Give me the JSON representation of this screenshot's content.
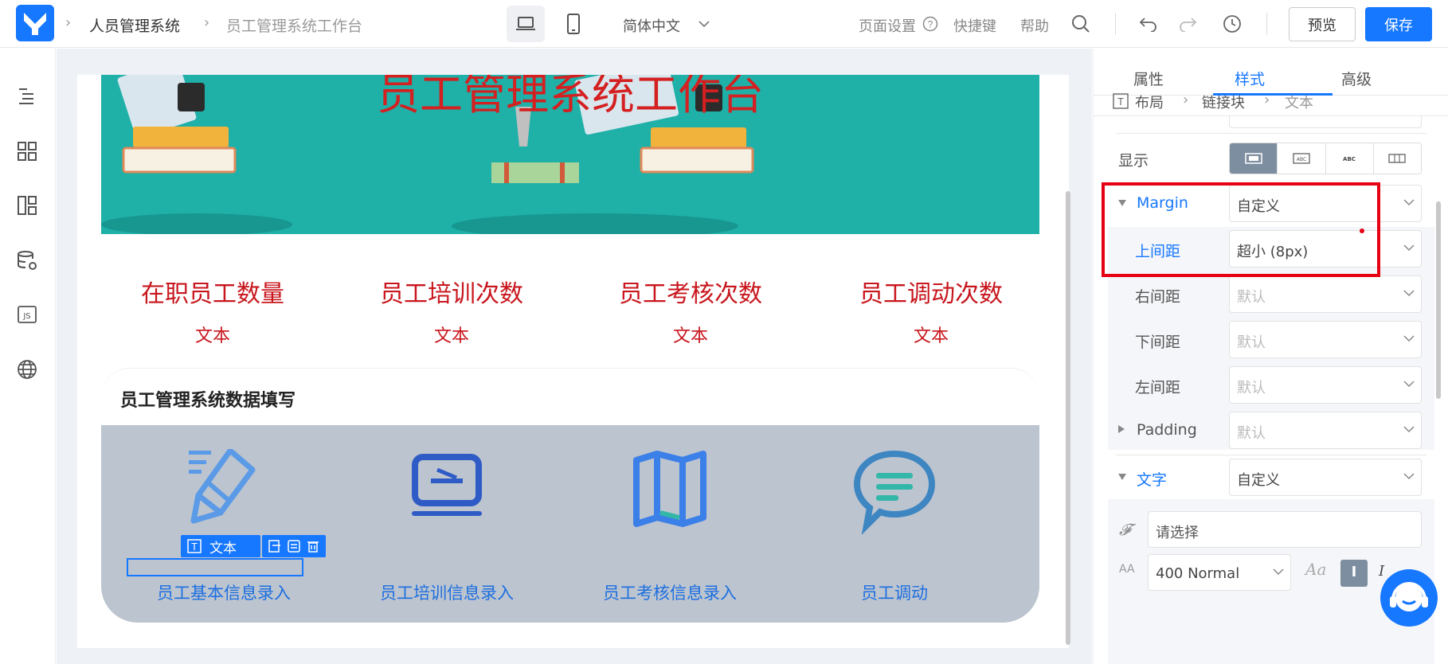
{
  "header": {
    "breadcrumb": [
      "人员管理系统",
      "员工管理系统工作台"
    ],
    "language": "简体中文",
    "page_settings": "页面设置",
    "shortcuts": "快捷键",
    "help": "帮助",
    "preview": "预览",
    "save": "保存"
  },
  "canvas": {
    "banner_title": "员工管理系统工作台",
    "stats": [
      {
        "title": "在职员工数量",
        "value": "文本"
      },
      {
        "title": "员工培训次数",
        "value": "文本"
      },
      {
        "title": "员工考核次数",
        "value": "文本"
      },
      {
        "title": "员工调动次数",
        "value": "文本"
      }
    ],
    "section_title": "员工管理系统数据填写",
    "tiles": [
      {
        "label": "员工基本信息录入",
        "icon": "pencil-icon"
      },
      {
        "label": "员工培训信息录入",
        "icon": "monitor-icon"
      },
      {
        "label": "员工考核信息录入",
        "icon": "map-icon"
      },
      {
        "label": "员工调动",
        "icon": "chat-icon"
      }
    ],
    "selection_tag": "文本"
  },
  "panel": {
    "tabs": [
      "属性",
      "样式",
      "高级"
    ],
    "active_tab": "样式",
    "path": [
      "布局",
      "链接块",
      "文本"
    ],
    "display_label": "显示",
    "margin": {
      "label": "Margin",
      "value": "自定义"
    },
    "top": {
      "label": "上间距",
      "value": "超小 (8px)"
    },
    "right": {
      "label": "右间距",
      "placeholder": "默认"
    },
    "bottom": {
      "label": "下间距",
      "placeholder": "默认"
    },
    "left": {
      "label": "左间距",
      "placeholder": "默认"
    },
    "padding": {
      "label": "Padding",
      "placeholder": "默认"
    },
    "text": {
      "label": "文字",
      "value": "自定义"
    },
    "font_placeholder": "请选择",
    "font_weight": "400 Normal"
  },
  "colors": {
    "accent": "#1677ff",
    "highlight": "#e60012",
    "stat_red": "#c8161d"
  }
}
